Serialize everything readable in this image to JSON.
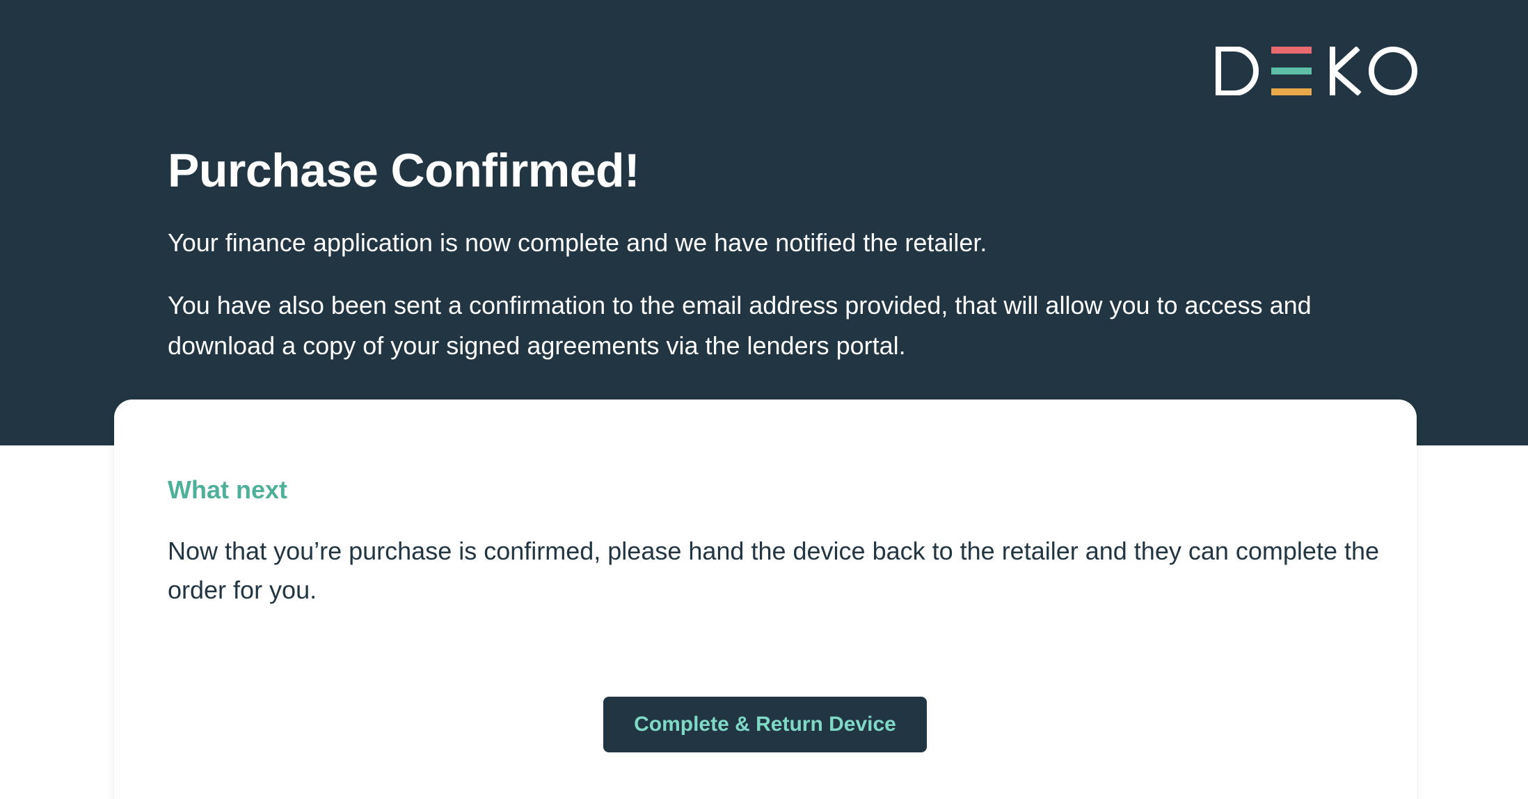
{
  "brand": {
    "logo_letters": "DEKO",
    "stripe_colors": [
      "#e66a6f",
      "#5dbfa7",
      "#e9a84a"
    ],
    "text_color": "#ffffff",
    "accent": "#4fb09a",
    "dark": "#213642"
  },
  "header": {
    "title": "Purchase Confirmed!",
    "intro_line_1": "Your finance application is now complete and we have notified the retailer.",
    "intro_line_2": "You have also been sent a confirmation to the email address provided, that will allow you to access and download a copy of your signed agreements via the lenders portal."
  },
  "card": {
    "heading": "What next",
    "body": "Now that you’re purchase is confirmed, please hand the device back to the retailer and they can complete the order for you.",
    "button_label": "Complete & Return Device"
  }
}
